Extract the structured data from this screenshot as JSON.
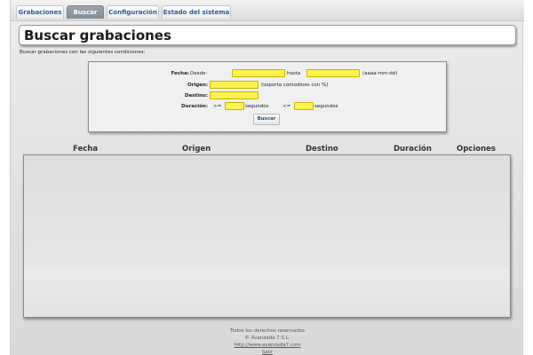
{
  "tabs": [
    {
      "label": "Grabaciones",
      "active": false
    },
    {
      "label": "Buscar",
      "active": true
    },
    {
      "label": "Configuración",
      "active": false
    },
    {
      "label": "Estado del sistema",
      "active": false
    }
  ],
  "page": {
    "title": "Buscar grabaciones",
    "subtitle": "Buscar grabaciones con las siguientes condiciones:"
  },
  "form": {
    "fecha_label": "Fecha:",
    "desde_text": "Desde:",
    "desde_value": "",
    "hasta_text": "hasta",
    "hasta_value": "",
    "date_hint": "(aaaa-mm-dd)",
    "origen_label": "Origen:",
    "origen_value": "",
    "origen_hint": "(soporta comodines con %)",
    "destino_label": "Destino:",
    "destino_value": "",
    "duracion_label": "Duración:",
    "gte_text": ">=",
    "dur_min_value": "",
    "segundos1": "segundos",
    "lte_text": "<=",
    "dur_max_value": "",
    "segundos2": "segundos",
    "search_button": "Buscar"
  },
  "results": {
    "columns": [
      "Fecha",
      "Origen",
      "Destino",
      "Duración",
      "Opciones"
    ],
    "rows": []
  },
  "footer": {
    "rights": "Todos los derechos reservados",
    "company": "© Avanzada 7 S.L.",
    "url": "http://www.avanzada7.com",
    "logout": "Salir"
  },
  "colors": {
    "input_highlight": "#fff34d",
    "tab_active": "#8a949e",
    "link_blue": "#2a5d9a"
  }
}
